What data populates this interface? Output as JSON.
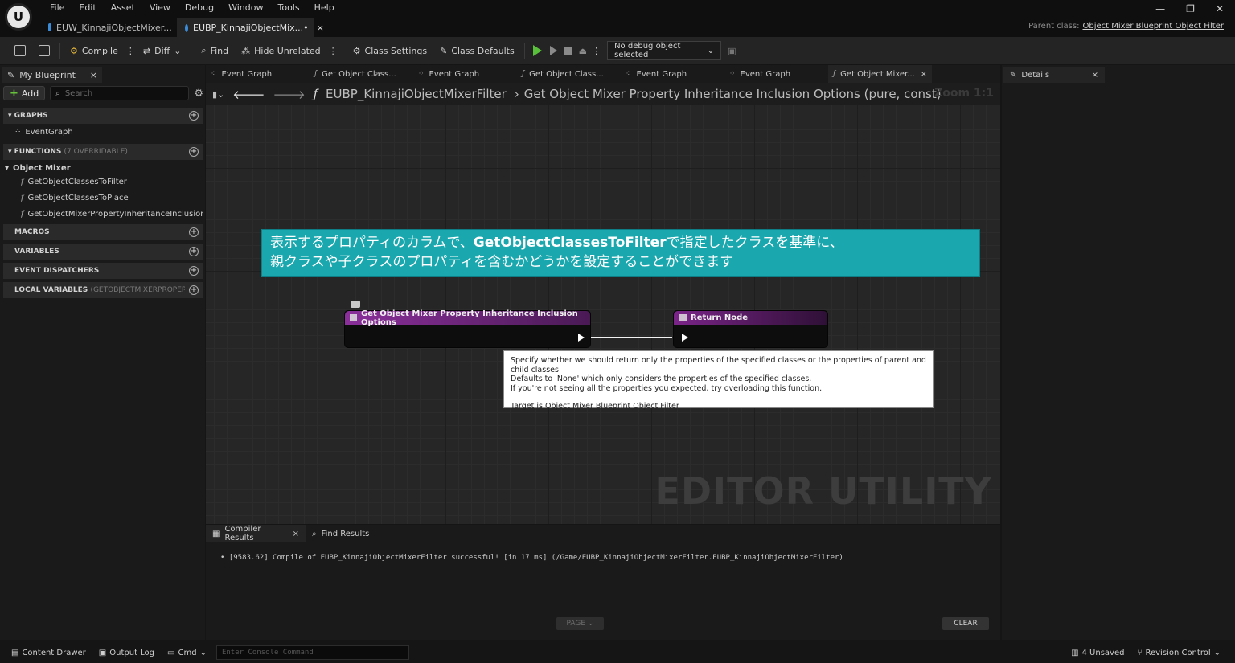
{
  "menu": [
    "File",
    "Edit",
    "Asset",
    "View",
    "Debug",
    "Window",
    "Tools",
    "Help"
  ],
  "doc_tabs": [
    {
      "label": "EUW_KinnajiObjectMixer..."
    },
    {
      "label": "EUBP_KinnajiObjectMix...•"
    }
  ],
  "parent_class": {
    "label": "Parent class:",
    "value": "Object Mixer Blueprint Object Filter"
  },
  "toolbar": {
    "compile": "Compile",
    "diff": "Diff",
    "find": "Find",
    "hide_unrelated": "Hide Unrelated",
    "class_settings": "Class Settings",
    "class_defaults": "Class Defaults",
    "debug_object": "No debug object selected"
  },
  "my_blueprint": {
    "tab": "My Blueprint",
    "add": "Add",
    "search_placeholder": "Search",
    "sections": {
      "graphs": "GRAPHS",
      "functions": "FUNCTIONS",
      "functions_sub": "(7 OVERRIDABLE)",
      "macros": "MACROS",
      "variables": "VARIABLES",
      "event_dispatchers": "EVENT DISPATCHERS",
      "local_variables": "LOCAL VARIABLES",
      "local_variables_sub": "(GETOBJECTMIXERPROPERTYIN"
    },
    "graph_items": [
      "EventGraph"
    ],
    "category": "Object Mixer",
    "functions": [
      "GetObjectClassesToFilter",
      "GetObjectClassesToPlace",
      "GetObjectMixerPropertyInheritanceInclusion("
    ]
  },
  "graph_tabs": [
    "Event Graph",
    "Get Object Class...",
    "Event Graph",
    "Get Object Class...",
    "Event Graph",
    "Event Graph",
    "Get Object Mixer..."
  ],
  "breadcrumb": {
    "blueprint": "EUBP_KinnajiObjectMixerFilter",
    "function": "Get Object Mixer Property Inheritance Inclusion Options (pure, const)",
    "zoom": "Zoom 1:1"
  },
  "comment": {
    "line1_a": "表示するプロパティのカラムで、",
    "line1_b": "GetObjectClassesToFilter",
    "line1_c": "で指定したクラスを基準に、",
    "line2": "親クラスや子クラスのプロパティを含むかどうかを設定することができます"
  },
  "nodes": {
    "entry": "Get Object Mixer Property Inheritance Inclusion Options",
    "return": "Return Node"
  },
  "tooltip": {
    "line1": "Specify whether we should return only the properties of the specified classes or the properties of parent and child classes.",
    "line2": "Defaults to 'None' which only considers the properties of the specified classes.",
    "line3": "If you're not seeing all the properties you expected, try overloading this function.",
    "line4": "Target is Object Mixer Blueprint Object Filter"
  },
  "watermark": "EDITOR UTILITY",
  "bottom": {
    "compiler_tab": "Compiler Results",
    "find_tab": "Find Results",
    "log": "[9583.62] Compile of EUBP_KinnajiObjectMixerFilter successful! [in 17 ms] (/Game/EUBP_KinnajiObjectMixerFilter.EUBP_KinnajiObjectMixerFilter)",
    "page": "PAGE",
    "clear": "CLEAR"
  },
  "details": {
    "tab": "Details"
  },
  "statusbar": {
    "content_drawer": "Content Drawer",
    "output_log": "Output Log",
    "cmd": "Cmd",
    "console_placeholder": "Enter Console Command",
    "unsaved": "4 Unsaved",
    "revision_control": "Revision Control"
  },
  "colors": {
    "comment_bg": "#1aa7ae",
    "entry_header": "#7b2a8a",
    "return_header": "#6a1f7a",
    "play": "#58c03a"
  }
}
